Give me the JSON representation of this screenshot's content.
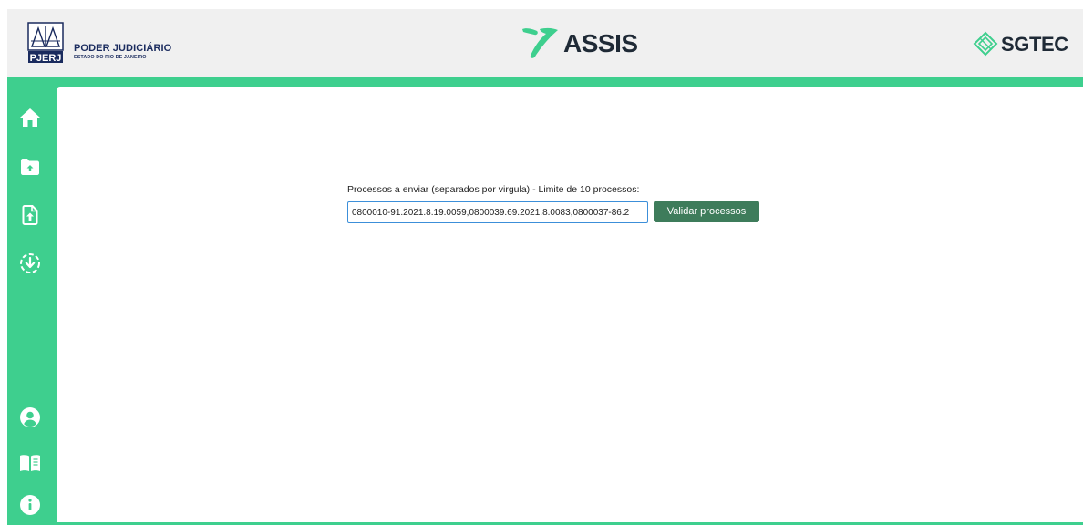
{
  "header": {
    "pjerj_badge": "PJERJ",
    "org_title": "PODER JUDICIÁRIO",
    "org_subtitle": "ESTADO DO RIO DE JANEIRO",
    "app_name": "ASSIS",
    "partner_name": "SGTEC"
  },
  "colors": {
    "brand_green": "#3ecf8e",
    "button_green": "#3e7c5b",
    "navy": "#1a2b5e"
  },
  "sidebar": {
    "top_items": [
      {
        "icon": "home-icon"
      },
      {
        "icon": "folder-upload-icon"
      },
      {
        "icon": "file-upload-icon"
      },
      {
        "icon": "circle-download-icon"
      }
    ],
    "bottom_items": [
      {
        "icon": "user-circle-icon"
      },
      {
        "icon": "book-open-icon"
      },
      {
        "icon": "info-icon"
      }
    ]
  },
  "form": {
    "label": "Processos a enviar (separados por virgula) - Limite de 10 processos:",
    "input_value": "0800010-91.2021.8.19.0059,0800039.69.2021.8.0083,0800037-86.2",
    "button_label": "Validar processos"
  }
}
